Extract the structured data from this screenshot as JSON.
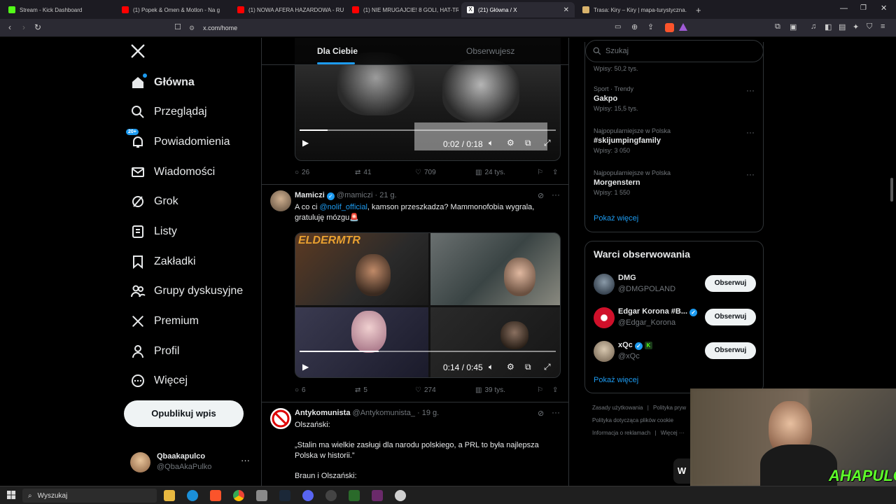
{
  "browser": {
    "tabs": [
      {
        "label": "Stream - Kick Dashboard",
        "color": "#53fc18"
      },
      {
        "label": "(1) Popek & Omen & Motlon - Na g",
        "color": "#ff0000"
      },
      {
        "label": "(1) NOWA AFERA HAZARDOWA - RU",
        "color": "#ff0000"
      },
      {
        "label": "(1) NIE MRUGAJCIE! 8 GOLI, HAT-TR",
        "color": "#ff0000"
      },
      {
        "label": "(21) Główna / X",
        "color": "#ffffff"
      },
      {
        "label": "Trasa: Kiry – Kiry | mapa-turystyczna.",
        "color": "#d9b36c"
      }
    ],
    "new_tab": "+",
    "url": "x.com/home"
  },
  "nav": {
    "items": [
      {
        "label": "Główna",
        "icon": "home-icon"
      },
      {
        "label": "Przeglądaj",
        "icon": "search-icon"
      },
      {
        "label": "Powiadomienia",
        "icon": "bell-icon"
      },
      {
        "label": "Wiadomości",
        "icon": "mail-icon"
      },
      {
        "label": "Grok",
        "icon": "grok-icon"
      },
      {
        "label": "Listy",
        "icon": "list-icon"
      },
      {
        "label": "Zakładki",
        "icon": "bookmark-icon"
      },
      {
        "label": "Grupy dyskusyjne",
        "icon": "people-icon"
      },
      {
        "label": "Premium",
        "icon": "x-icon"
      },
      {
        "label": "Profil",
        "icon": "person-icon"
      },
      {
        "label": "Więcej",
        "icon": "more-circle-icon"
      }
    ],
    "notif_badge": "20+",
    "publish": "Opublikuj wpis",
    "account": {
      "name": "Qbaakapulco",
      "handle": "@QbaAkaPulko"
    }
  },
  "feed": {
    "tabs": [
      "Dla Ciebie",
      "Obserwujesz"
    ],
    "tweet1": {
      "video_time": "0:02 / 0:18",
      "progress": 0.11,
      "stats": {
        "replies": "26",
        "reposts": "41",
        "likes": "709",
        "views": "24 tys."
      }
    },
    "tweet2": {
      "name": "Mamiczi",
      "handle": "@mamiczi",
      "time": "· 21 g.",
      "mention": "@nolif_official",
      "text_before": "A co ci ",
      "text_after": ", kamson przeszkadza? Mammonofobia wygrala, gratuluję mózgu🚨",
      "video_time": "0:14 / 0:45",
      "progress": 0.31,
      "stats": {
        "replies": "6",
        "reposts": "5",
        "likes": "274",
        "views": "39 tys."
      }
    },
    "tweet3": {
      "name": "Antykomunista",
      "handle": "@Antykomunista_",
      "time": "· 19 g.",
      "line1": "Olszański:",
      "quote": "„Stalin ma wielkie zasługi dla narodu polskiego, a PRL to była najlepsza Polska w historii.”",
      "line3": "Braun i Olszański:"
    }
  },
  "right": {
    "search_placeholder": "Szukaj",
    "trends_top_count": "Wpisy: 50,2 tys.",
    "trends": [
      {
        "category": "Sport · Trendy",
        "name": "Gakpo",
        "count": "Wpisy: 15,5 tys."
      },
      {
        "category": "Najpopularniejsze w Polska",
        "name": "#skijumpingfamily",
        "count": "Wpisy: 3 050"
      },
      {
        "category": "Najpopularniejsze w Polska",
        "name": "Morgenstern",
        "count": "Wpisy: 1 550"
      }
    ],
    "show_more": "Pokaż więcej",
    "who_to_follow_title": "Warci obserwowania",
    "who_to_follow": [
      {
        "name": "DMG",
        "handle": "@DMGPOLAND",
        "button": "Obserwuj"
      },
      {
        "name": "Edgar Korona #B...",
        "handle": "@Edgar_Korona",
        "button": "Obserwuj"
      },
      {
        "name": "xQc",
        "handle": "@xQc",
        "button": "Obserwuj"
      }
    ],
    "show_more2": "Pokaż więcej",
    "footer": {
      "terms": "Zasady użytkowania",
      "privacy": "Polityka pryw",
      "cookies": "Polityka dotycząca plików cookie",
      "ads": "Informacja o reklamach",
      "more": "Więcej ···"
    }
  },
  "overlay": {
    "brand": "AHAPULCO"
  },
  "taskbar": {
    "search": "Wyszukaj"
  }
}
